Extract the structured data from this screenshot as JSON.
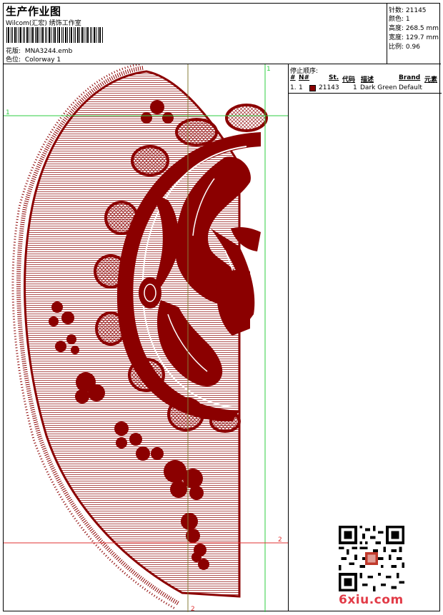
{
  "header": {
    "title": "生产作业图",
    "subtitle": "Wilcom(汇宏) 绣饰工作室",
    "file_label": "花版:",
    "file_value": "MNA3244.emb",
    "color_label": "色位:",
    "color_value": "Colorway 1"
  },
  "stats": {
    "stitches": "针数: 21145",
    "colors": "颜色: 1",
    "height": "高度: 268.5 mm",
    "width": "宽度: 129.7 mm",
    "scale": "比例: 0.96"
  },
  "stop_sequence": {
    "title": "停止顺序:",
    "columns": [
      "#",
      "N#",
      "St.",
      "代码",
      "描述",
      "Brand",
      "元素"
    ],
    "rows": [
      {
        "num": "1.",
        "needle": "1",
        "stitches": "21143",
        "code": "1",
        "description": "Dark Green",
        "brand": "Default",
        "swatch_color": "#8b0000"
      }
    ]
  },
  "guides": {
    "marker_1_top": "1",
    "marker_1_left": "1",
    "marker_2_right": "2",
    "marker_2_bottom": "2"
  },
  "watermark": {
    "text": "6xiu.com",
    "color": "#e23b47"
  },
  "design": {
    "thread_color": "#8b0000"
  }
}
